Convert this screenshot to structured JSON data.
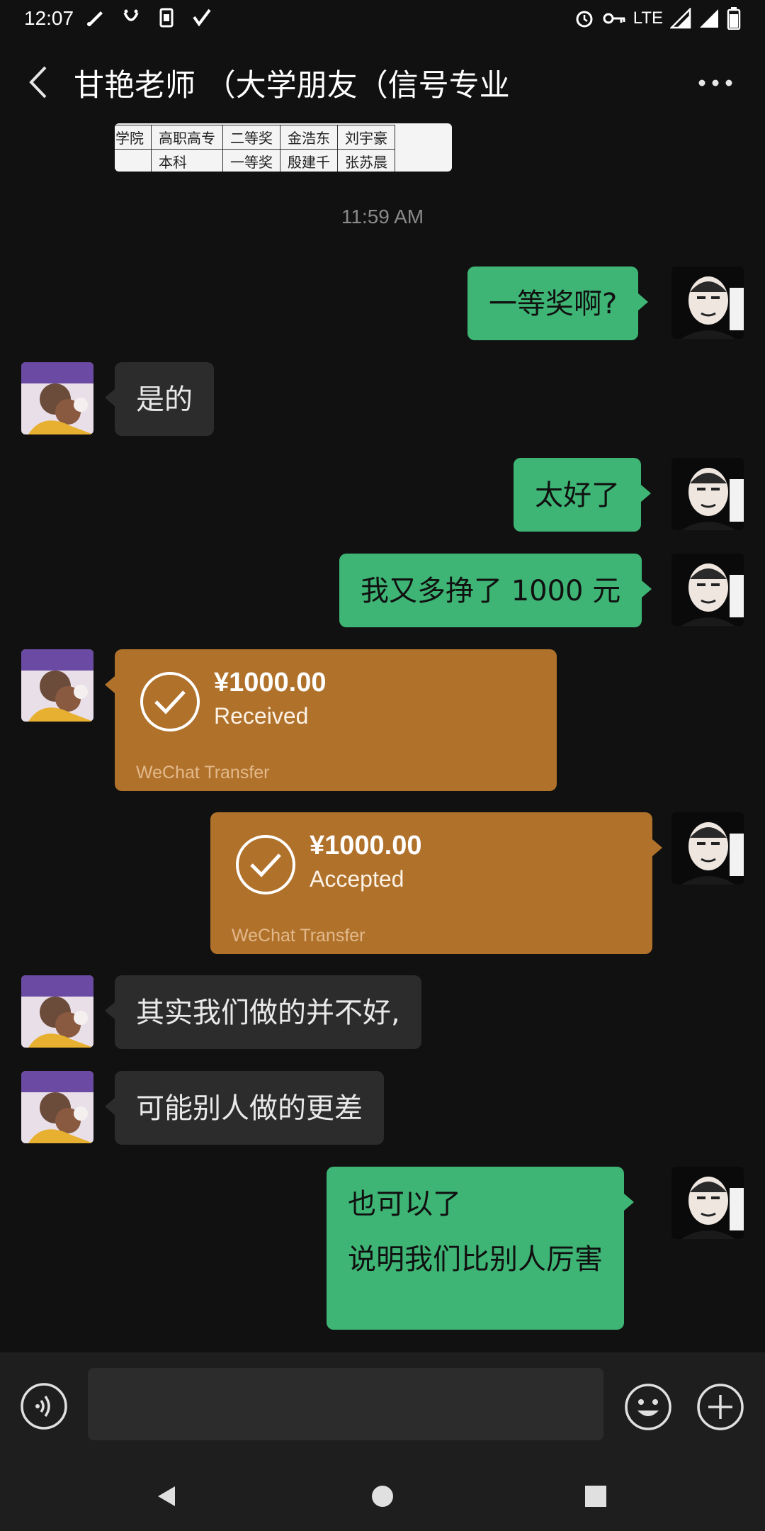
{
  "status_bar": {
    "time": "12:07",
    "network": "LTE"
  },
  "header": {
    "title": "甘艳老师 （大学朋友（信号专业"
  },
  "image_preview": {
    "rows": [
      [
        "学院",
        "高职高专",
        "二等奖",
        "金浩东",
        "刘宇豪"
      ],
      [
        "",
        "本科",
        "一等奖",
        "殷建千",
        "张苏晨"
      ]
    ]
  },
  "timestamp": "11:59 AM",
  "messages": {
    "m1": "一等奖啊?",
    "m2": "是的",
    "m3": "太好了",
    "m4": "我又多挣了 1000 元",
    "t1": {
      "amount": "¥1000.00",
      "state": "Received",
      "label": "WeChat Transfer"
    },
    "t2": {
      "amount": "¥1000.00",
      "state": "Accepted",
      "label": "WeChat Transfer"
    },
    "m5": "其实我们做的并不好,",
    "m6": "可能别人做的更差",
    "m7_line1": "也可以了",
    "m7_line2": "说明我们比别人厉害"
  },
  "input": {
    "value": "",
    "placeholder": ""
  },
  "colors": {
    "background": "#111111",
    "bubble_self": "#3eb575",
    "bubble_other": "#2c2c2c",
    "transfer": "#b0712b"
  }
}
